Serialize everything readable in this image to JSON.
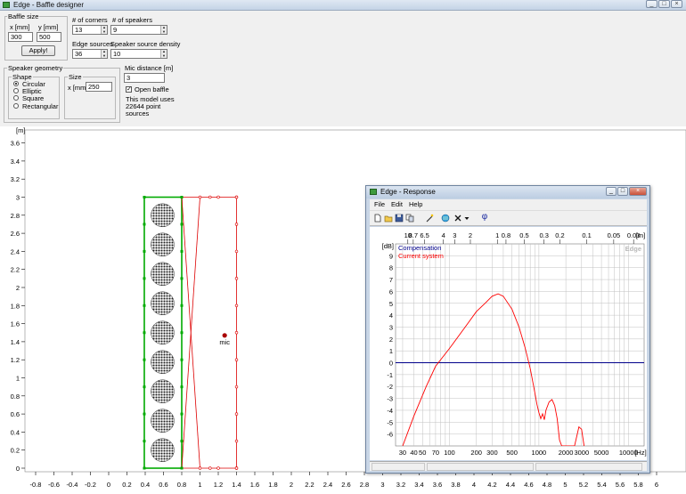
{
  "window": {
    "title": "Edge - Baffle designer",
    "min": "_",
    "max": "□",
    "close": "×"
  },
  "baffle_size": {
    "label": "Baffle size",
    "x_label": "x [mm]",
    "y_label": "y [mm]",
    "x_value": "300",
    "y_value": "500",
    "apply_label": "Apply!"
  },
  "corners": {
    "label": "# of corners",
    "value": "13"
  },
  "speakers": {
    "label": "# of speakers",
    "value": "9"
  },
  "edge_sources": {
    "label": "Edge sources",
    "value": "36"
  },
  "speaker_density": {
    "label": "Speaker source density",
    "value": "10"
  },
  "geometry": {
    "label": "Speaker geometry",
    "shape_label": "Shape",
    "shapes": [
      "Circular",
      "Elliptic",
      "Square",
      "Rectangular"
    ],
    "selected": 0,
    "size_label": "Size",
    "size_x_label": "x [mm]",
    "size_value": "250"
  },
  "mic": {
    "label": "Mic distance [m]",
    "value": "3",
    "open_baffle_label": "Open baffle",
    "open_baffle_checked": true,
    "note": [
      "This model uses",
      "22644 point",
      "sources"
    ],
    "marker_label": "mic"
  },
  "main_plot": {
    "unit": "[m]",
    "y_ticks": [
      "0",
      "0.2",
      "0.4",
      "0.6",
      "0.8",
      "1",
      "1.2",
      "1.4",
      "1.6",
      "1.8",
      "2",
      "2.2",
      "2.4",
      "2.6",
      "2.8",
      "3",
      "3.2",
      "3.4",
      "3.6"
    ],
    "x_ticks": [
      "-0.8",
      "-0.6",
      "-0.4",
      "-0.2",
      "0",
      "0.2",
      "0.4",
      "0.6",
      "0.8",
      "1",
      "1.2",
      "1.4",
      "1.6",
      "1.8",
      "2",
      "2.2",
      "2.4",
      "2.6",
      "2.8",
      "3",
      "3.2",
      "3.4",
      "3.6",
      "3.8",
      "4",
      "4.2",
      "4.4",
      "4.6",
      "4.8",
      "5",
      "5.2",
      "5.4",
      "5.6",
      "5.8",
      "6"
    ],
    "colors": {
      "grid": "#d9d9d9",
      "baffle": "#00aa00",
      "outline": "#dd0000",
      "speaker": "#202020"
    }
  },
  "response": {
    "title": "Edge - Response",
    "menu": [
      "File",
      "Edit",
      "Help"
    ],
    "toolbar_icons": [
      "new-file-icon",
      "open-folder-icon",
      "save-icon",
      "copy-icon",
      "magic-wand-icon",
      "globe-icon",
      "cross-icon",
      "dropdown-arrow-icon",
      "phase-icon"
    ],
    "phase_symbol": "φ",
    "legend": [
      "Compensation",
      "Current system"
    ],
    "watermark": "Edge",
    "db_label": "[dB]",
    "wavelength_unit": "[m]",
    "hz_unit": "[Hz]",
    "colors": {
      "compensation": "#00008b",
      "current": "#ff0000",
      "grid": "#c0c0c0"
    }
  },
  "chart_data": {
    "type": "line",
    "xscale": "log",
    "xlim": [
      25,
      15000
    ],
    "ylim": [
      -7,
      10
    ],
    "x_ticks": [
      "30",
      "40",
      "50",
      "70",
      "100",
      "200",
      "300",
      "500",
      "1000",
      "2000",
      "3000",
      "5000",
      "10000"
    ],
    "y_ticks": [
      "9",
      "8",
      "7",
      "6",
      "5",
      "4",
      "3",
      "2",
      "1",
      "0",
      "-1",
      "-2",
      "-3",
      "-4",
      "-5",
      "-6"
    ],
    "top_ticks": [
      "10",
      "8.7",
      "6.5",
      "4",
      "3",
      "2",
      "1",
      "0.8",
      "0.5",
      "0.3",
      "0.2",
      "0.1",
      "0.05",
      "0.03"
    ],
    "grid": true,
    "series": [
      {
        "name": "Compensation",
        "x": [
          25,
          15000
        ],
        "y": [
          0,
          0
        ]
      },
      {
        "name": "Current system",
        "x": [
          30,
          40,
          55,
          70,
          100,
          150,
          200,
          250,
          300,
          350,
          400,
          500,
          600,
          700,
          800,
          900,
          950,
          1000,
          1050,
          1100,
          1150,
          1200,
          1300,
          1400,
          1500,
          1600,
          1700,
          1800,
          2000,
          2200,
          2500,
          2800,
          3000,
          3200
        ],
        "y": [
          -7,
          -4.5,
          -2,
          -0.3,
          1.2,
          3,
          4.3,
          5,
          5.6,
          5.8,
          5.6,
          4.5,
          3,
          1.3,
          -0.5,
          -2.5,
          -3.5,
          -4.2,
          -4.7,
          -4.3,
          -4.8,
          -4,
          -3.3,
          -3.1,
          -3.6,
          -4.7,
          -6.5,
          -7,
          -7,
          -7,
          -7,
          -5.4,
          -5.6,
          -7
        ]
      }
    ]
  }
}
